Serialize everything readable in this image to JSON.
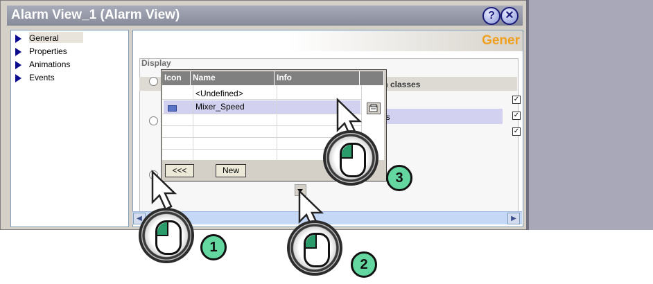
{
  "window": {
    "title": "Alarm View_1 (Alarm View)",
    "help_icon": "help-icon",
    "close_icon": "close-icon"
  },
  "tree": {
    "items": [
      {
        "label": "General",
        "selected": true
      },
      {
        "label": "Properties"
      },
      {
        "label": "Animations"
      },
      {
        "label": "Events"
      }
    ]
  },
  "panel": {
    "title": "Gener",
    "display_label": "Display",
    "alarm_classes_label": "m classes",
    "selected_row_text": "gs"
  },
  "popup": {
    "columns": [
      "Icon",
      "Name",
      "Info"
    ],
    "rows": [
      {
        "name": "<Undefined>",
        "info": ""
      },
      {
        "name": "Mixer_Speed",
        "info": "",
        "selected": true
      }
    ],
    "back_button": "<<<",
    "new_button": "New"
  },
  "callouts": [
    "1",
    "2",
    "3"
  ],
  "colors": {
    "title_bar": "#878a99",
    "heading_orange": "#f0a020",
    "callout_green": "#64d6a0"
  }
}
